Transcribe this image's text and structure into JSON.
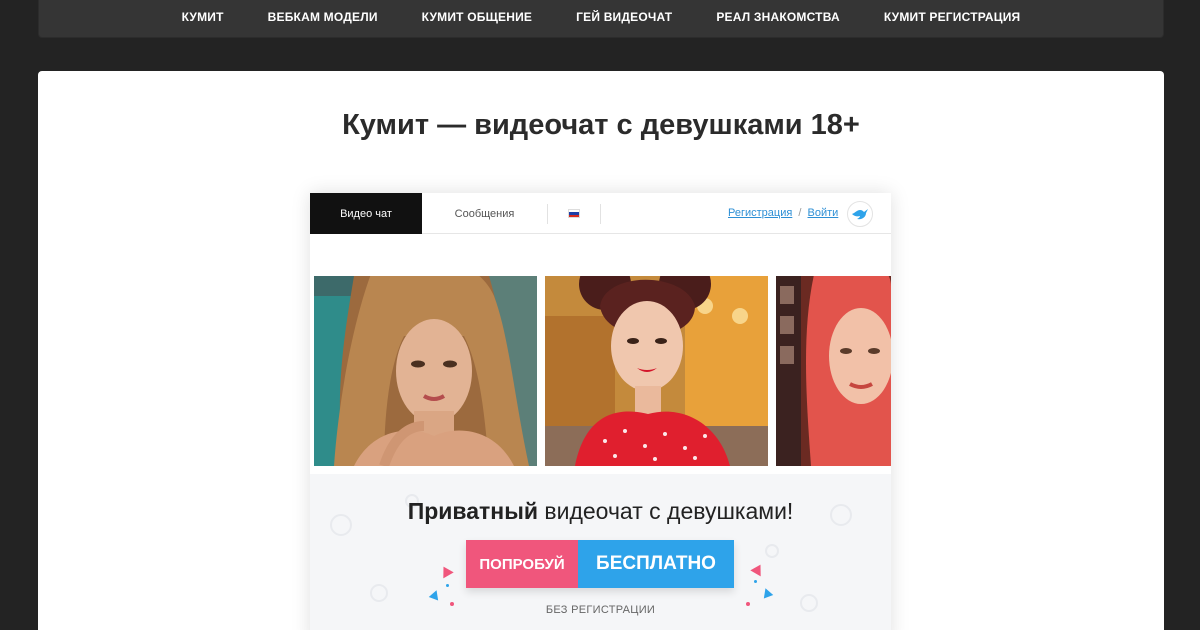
{
  "topnav": {
    "items": [
      {
        "label": "КУМИТ"
      },
      {
        "label": "ВЕБКАМ МОДЕЛИ"
      },
      {
        "label": "КУМИТ ОБЩЕНИЕ"
      },
      {
        "label": "ГЕЙ ВИДЕОЧАТ"
      },
      {
        "label": "РЕАЛ ЗНАКОМСТВА"
      },
      {
        "label": "КУМИТ РЕГИСТРАЦИЯ"
      }
    ]
  },
  "main": {
    "title": "Кумит — видеочат с девушками 18+"
  },
  "screenshot": {
    "tabs": {
      "video_chat": "Видео чат",
      "messages": "Сообщения"
    },
    "language_flag_icon": "russia-flag-icon",
    "auth": {
      "register": "Регистрация",
      "separator": "/",
      "login": "Войти"
    },
    "logo_icon": "bird-icon",
    "tagline": {
      "bold": "Приватный",
      "rest": " видеочат с девушками!"
    },
    "cta": {
      "left": "ПОПРОБУЙ",
      "right": "БЕСПЛАТНО"
    },
    "note": "БЕЗ РЕГИСТРАЦИИ"
  },
  "colors": {
    "page_bg": "#232323",
    "nav_bg": "#353535",
    "cta_pink": "#f0567c",
    "cta_blue": "#2ea3ea",
    "link_blue": "#2d8fd5"
  }
}
